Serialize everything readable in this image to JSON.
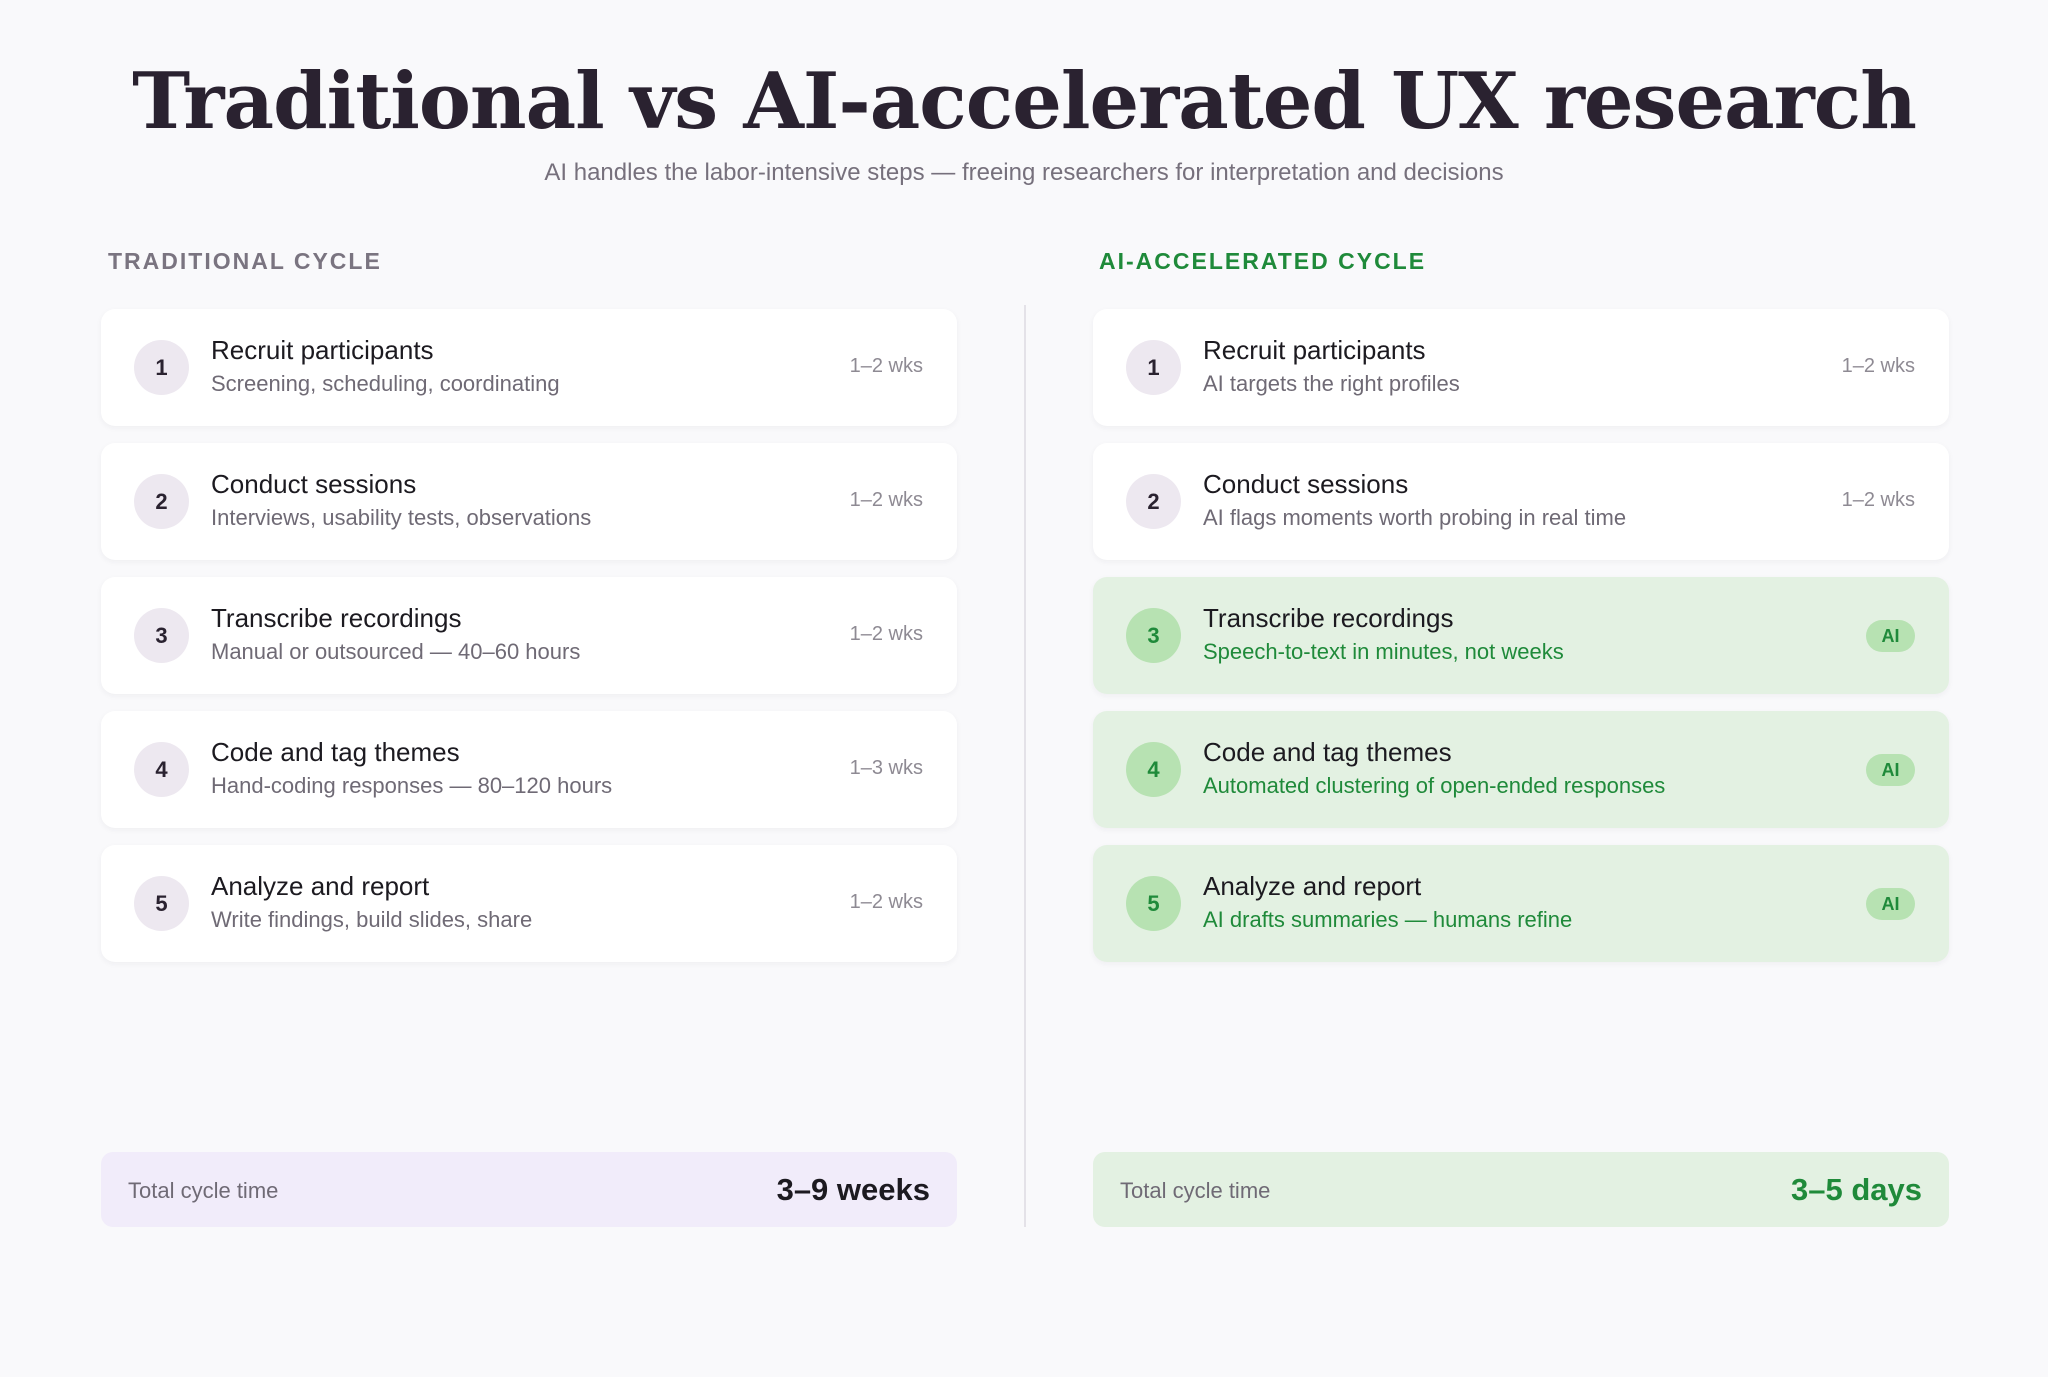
{
  "header": {
    "title": "Traditional vs AI-accelerated UX research",
    "subtitle": "AI handles the labor-intensive steps — freeing researchers for interpretation and decisions"
  },
  "traditional": {
    "heading": "TRADITIONAL CYCLE",
    "steps": [
      {
        "num": "1",
        "title": "Recruit participants",
        "desc": "Screening, scheduling, coordinating",
        "duration": "1–2 wks"
      },
      {
        "num": "2",
        "title": "Conduct sessions",
        "desc": "Interviews, usability tests, observations",
        "duration": "1–2 wks"
      },
      {
        "num": "3",
        "title": "Transcribe recordings",
        "desc": "Manual or outsourced — 40–60 hours",
        "duration": "1–2 wks"
      },
      {
        "num": "4",
        "title": "Code and tag themes",
        "desc": "Hand-coding responses — 80–120 hours",
        "duration": "1–3 wks"
      },
      {
        "num": "5",
        "title": "Analyze and report",
        "desc": "Write findings, build slides, share",
        "duration": "1–2 wks"
      }
    ],
    "total_label": "Total cycle time",
    "total_value": "3–9 weeks"
  },
  "ai": {
    "heading": "AI-ACCELERATED CYCLE",
    "steps": [
      {
        "num": "1",
        "title": "Recruit participants",
        "desc": "AI targets the right profiles",
        "duration": "1–2 wks"
      },
      {
        "num": "2",
        "title": "Conduct sessions",
        "desc": "AI flags moments worth probing in real time",
        "duration": "1–2 wks"
      },
      {
        "num": "3",
        "title": "Transcribe recordings",
        "desc": "Speech-to-text in minutes, not weeks",
        "badge": "AI"
      },
      {
        "num": "4",
        "title": "Code and tag themes",
        "desc": "Automated clustering of open-ended responses",
        "badge": "AI"
      },
      {
        "num": "5",
        "title": "Analyze and report",
        "desc": "AI drafts summaries — humans refine",
        "badge": "AI"
      }
    ],
    "total_label": "Total cycle time",
    "total_value": "3–5 days"
  },
  "colors": {
    "ai_green": "#1f8a3a",
    "ai_bg": "#e3f1e2",
    "trad_total_bg": "#f1ecfa"
  }
}
